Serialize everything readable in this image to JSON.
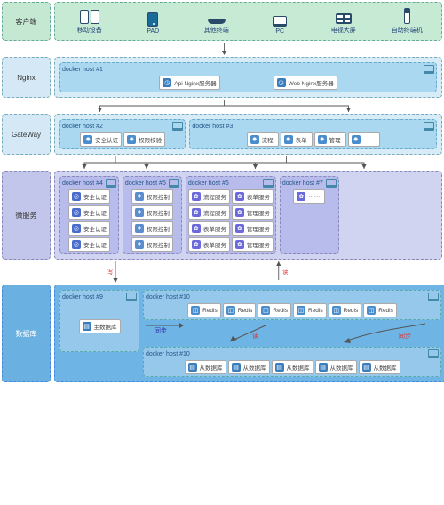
{
  "labels": {
    "client": "客户端",
    "nginx": "Nginx",
    "gateway": "GateWay",
    "micro": "微服务",
    "db": "数据库"
  },
  "clients": [
    {
      "name": "移动设备",
      "dev": "phone"
    },
    {
      "name": "PAD",
      "dev": "pad"
    },
    {
      "name": "其他终端",
      "dev": "scan"
    },
    {
      "name": "PC",
      "dev": "pc"
    },
    {
      "name": "电视大屏",
      "dev": "tv"
    },
    {
      "name": "自助终端机",
      "dev": "kiosk"
    }
  ],
  "nginx": {
    "host": "docker host #1",
    "items": [
      "Api Nginx服务器",
      "Web Nginx服务器"
    ]
  },
  "gateway": [
    {
      "host": "docker host #2",
      "items": [
        "安全认证",
        "权限校验"
      ]
    },
    {
      "host": "docker host #3",
      "items": [
        "流程",
        "表单",
        "管理",
        "······"
      ]
    }
  ],
  "micro": [
    {
      "host": "docker host #4",
      "cls": "purple",
      "cols": [
        [
          "安全认证",
          "安全认证",
          "安全认证",
          "安全认证"
        ]
      ],
      "icon": "ring"
    },
    {
      "host": "docker host #5",
      "cls": "purple",
      "cols": [
        [
          "权限控制",
          "权限控制",
          "权限控制",
          "权限控制"
        ]
      ],
      "icon": "mid"
    },
    {
      "host": "docker host #6",
      "cls": "purple",
      "cols": [
        [
          "流程服务",
          "流程服务",
          "表单服务",
          "表单服务"
        ],
        [
          "表单服务",
          "管理服务",
          "管理服务",
          "管理服务"
        ]
      ],
      "icon": "gear"
    },
    {
      "host": "docker host #7",
      "cls": "purple",
      "cols": [
        [
          "······"
        ]
      ],
      "icon": "gear"
    }
  ],
  "db": {
    "main": {
      "host": "docker host #9",
      "items": [
        "主数据库"
      ]
    },
    "redis": {
      "host": "docker host #10",
      "items": [
        "Redis",
        "Redis",
        "Redis",
        "Redis",
        "Redis",
        "Redis"
      ]
    },
    "slave": {
      "host": "docker host #10",
      "items": [
        "从数据库",
        "从数据库",
        "从数据库",
        "从数据库",
        "从数据库"
      ]
    }
  },
  "edges": {
    "write": "写",
    "read": "读",
    "sync": "同步"
  }
}
